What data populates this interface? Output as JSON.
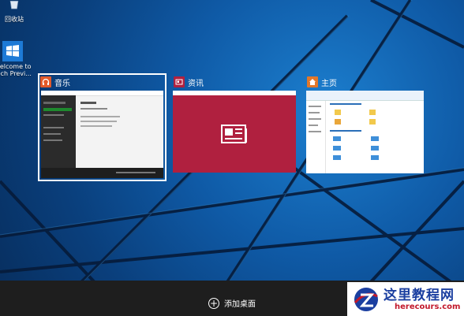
{
  "desktop": {
    "icons": [
      {
        "name": "recycle-bin",
        "label": "回收站"
      },
      {
        "name": "welcome",
        "label_line1": "Welcome to",
        "label_line2": "Tech Previ..."
      }
    ]
  },
  "task_view": {
    "windows": [
      {
        "id": "music",
        "title": "音乐",
        "icon": "headphones-icon",
        "accent": "#e25a2a",
        "focused": true
      },
      {
        "id": "news",
        "title": "资讯",
        "icon": "news-icon",
        "accent": "#b0203f",
        "focused": false
      },
      {
        "id": "home",
        "title": "主页",
        "icon": "home-icon",
        "accent": "#e2772a",
        "focused": false
      }
    ]
  },
  "bottom_bar": {
    "add_desktop_label": "添加桌面"
  },
  "watermark": {
    "title": "这里教程网",
    "url": "herecours.com"
  },
  "colors": {
    "bar": "#1e1e1e",
    "news_tile": "#b0203f"
  }
}
